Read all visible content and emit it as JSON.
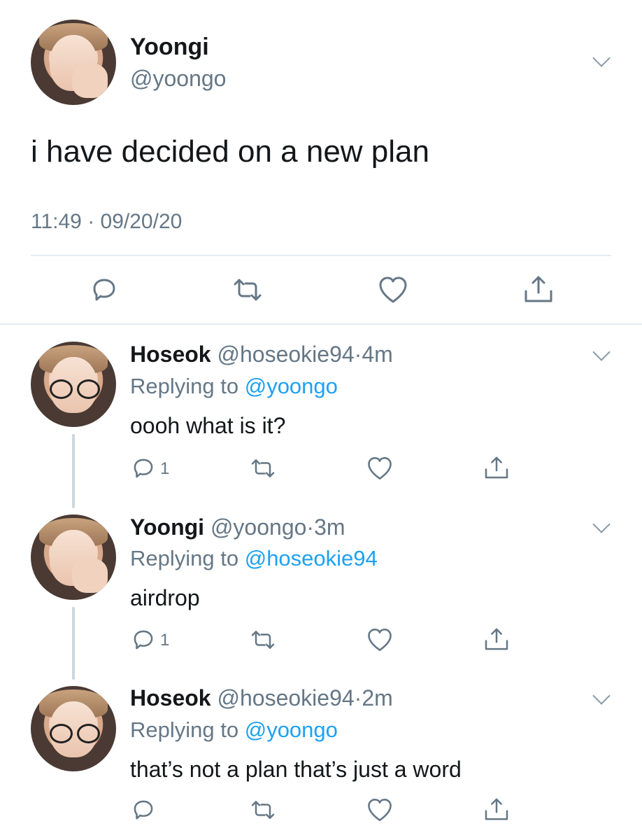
{
  "main_tweet": {
    "name": "Yoongi",
    "handle": "@yoongo",
    "text": "i have decided on a new plan",
    "time": "11:49",
    "separator": "·",
    "date": "09/20/20"
  },
  "replies": [
    {
      "name": "Hoseok",
      "handle": "@hoseokie94",
      "separator": "·",
      "age": "4m",
      "replying_prefix": "Replying to",
      "replying_to": "@yoongo",
      "text": "oooh what is it?",
      "reply_count": "1"
    },
    {
      "name": "Yoongi",
      "handle": "@yoongo",
      "separator": "·",
      "age": "3m",
      "replying_prefix": "Replying to",
      "replying_to": "@hoseokie94",
      "text": "airdrop",
      "reply_count": "1"
    },
    {
      "name": "Hoseok",
      "handle": "@hoseokie94",
      "separator": "·",
      "age": "2m",
      "replying_prefix": "Replying to",
      "replying_to": "@yoongo",
      "text": "that’s not a plan that’s just a word",
      "reply_count": ""
    }
  ],
  "icons": [
    "reply-icon",
    "retweet-icon",
    "like-icon",
    "share-icon",
    "chevron-down-icon"
  ],
  "colors": {
    "text": "#14171a",
    "secondary": "#657786",
    "link": "#1da1f2",
    "icon": "#657786",
    "divider": "#e6ecf0"
  }
}
